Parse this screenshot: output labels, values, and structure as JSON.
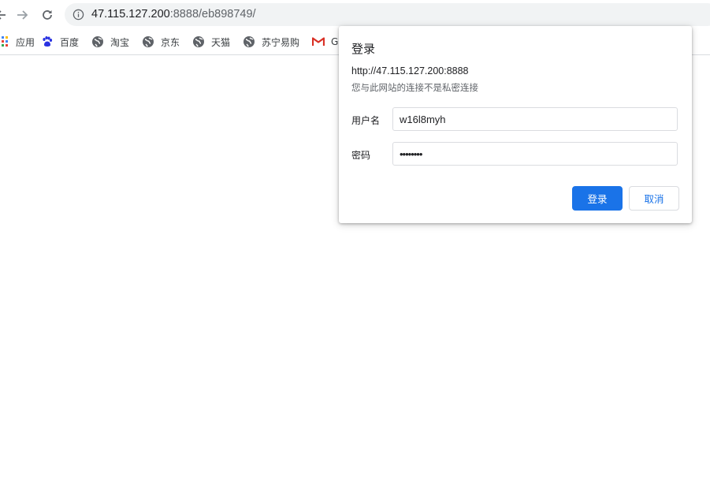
{
  "toolbar": {
    "url_host": "47.115.127.200",
    "url_path": ":8888/eb898749/"
  },
  "bookmarks": [
    {
      "label": "应用",
      "icon": "apps-grid-icon"
    },
    {
      "label": "百度",
      "icon": "baidu-paw-icon"
    },
    {
      "label": "淘宝",
      "icon": "globe-icon"
    },
    {
      "label": "京东",
      "icon": "globe-icon"
    },
    {
      "label": "天猫",
      "icon": "globe-icon"
    },
    {
      "label": "苏宁易购",
      "icon": "globe-icon"
    },
    {
      "label": "G",
      "icon": "gmail-icon"
    }
  ],
  "dialog": {
    "title": "登录",
    "origin": "http://47.115.127.200:8888",
    "warning": "您与此网站的连接不是私密连接",
    "username_label": "用户名",
    "username_value": "w16l8myh",
    "password_label": "密码",
    "password_value": "••••••••",
    "login_button": "登录",
    "cancel_button": "取消"
  },
  "colors": {
    "accent": "#1a73e8",
    "omnibox_bg": "#f1f3f4",
    "gmail_red": "#d93025",
    "baidu_blue": "#2932e1"
  }
}
